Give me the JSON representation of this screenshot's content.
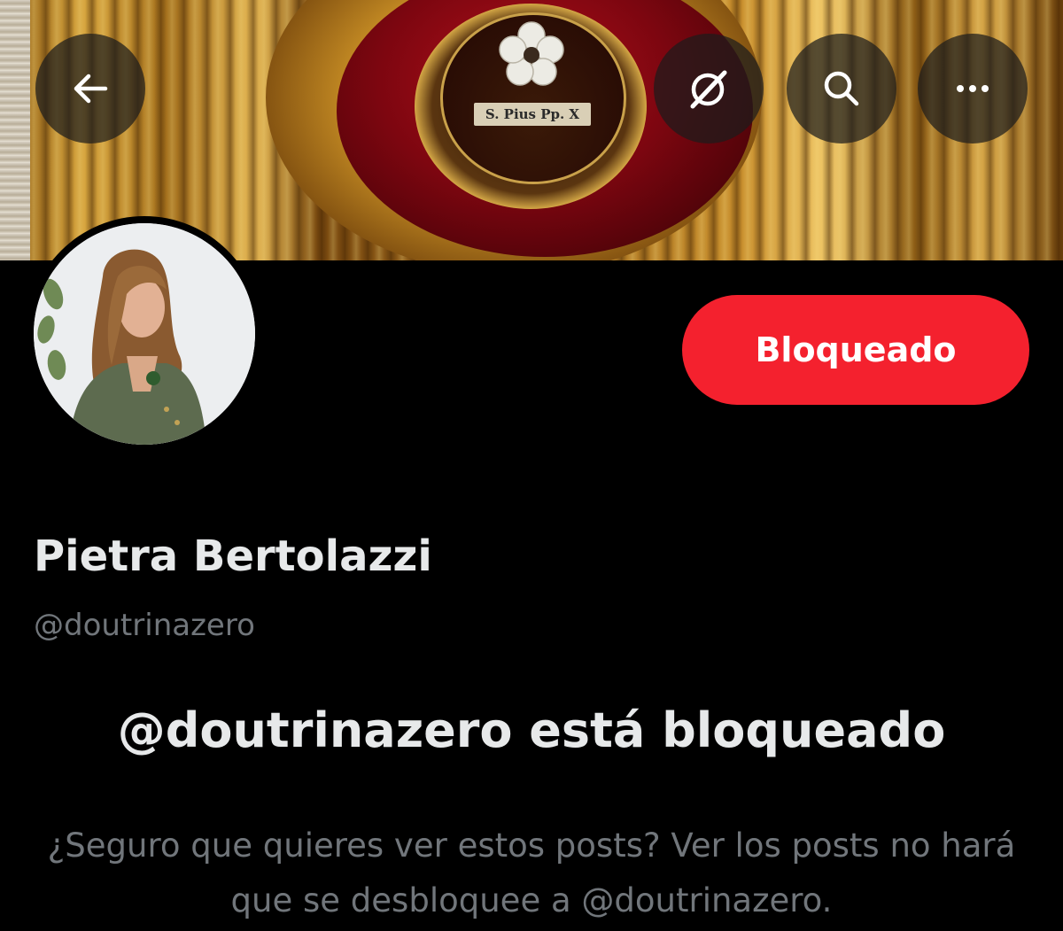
{
  "header": {
    "back_icon": "arrow-left-icon",
    "grok_icon": "grok-slash-icon",
    "search_icon": "search-icon",
    "more_icon": "more-horizontal-icon",
    "banner_label": "S. Pius Pp. X"
  },
  "profile": {
    "display_name": "Pietra Bertolazzi",
    "handle": "@doutrinazero",
    "blocked_button_label": "Bloqueado"
  },
  "blocked_notice": {
    "title": "@doutrinazero está bloqueado",
    "description": "¿Seguro que quieres ver estos posts? Ver los posts no hará que se desbloquee a @doutrinazero."
  },
  "colors": {
    "background": "#000000",
    "primary_text": "#e7e9ea",
    "secondary_text": "#71767b",
    "blocked_red": "#f4212e"
  }
}
